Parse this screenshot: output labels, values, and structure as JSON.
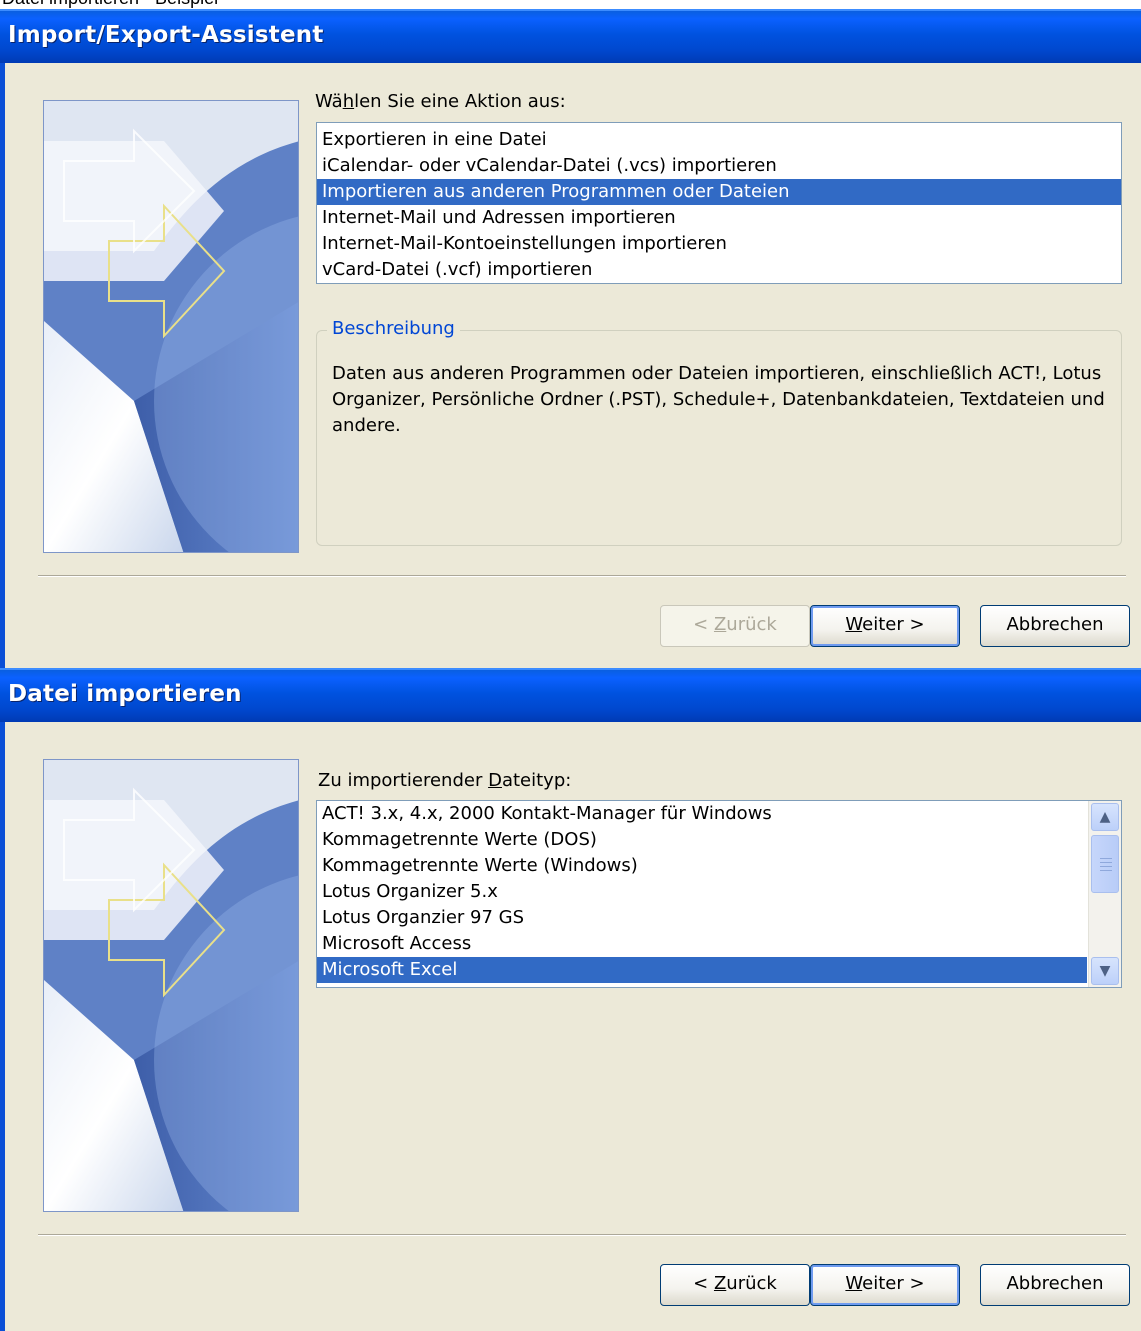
{
  "cutoff_text": "Datei importieren - Beispiel",
  "dialog1": {
    "title": "Import/Export-Assistent",
    "prompt_pre": "Wä",
    "prompt_u": "h",
    "prompt_post": "len Sie eine Aktion aus:",
    "items": [
      "Exportieren in eine Datei",
      "iCalendar- oder vCalendar-Datei (.vcs) importieren",
      "Importieren aus anderen Programmen oder Dateien",
      "Internet-Mail und Adressen importieren",
      "Internet-Mail-Kontoeinstellungen importieren",
      "vCard-Datei (.vcf) importieren"
    ],
    "selected_index": 2,
    "group_title": "Beschreibung",
    "description": "Daten aus anderen Programmen oder Dateien importieren, einschließlich ACT!, Lotus Organizer, Persönliche Ordner (.PST), Schedule+, Datenbankdateien, Textdateien und andere."
  },
  "dialog2": {
    "title": "Datei importieren",
    "prompt_pre": "Zu importierender ",
    "prompt_u": "D",
    "prompt_post": "ateityp:",
    "items": [
      "ACT! 3.x, 4.x, 2000 Kontakt-Manager für Windows",
      "Kommagetrennte Werte (DOS)",
      "Kommagetrennte Werte (Windows)",
      "Lotus Organizer 5.x",
      "Lotus Organzier 97 GS",
      "Microsoft Access",
      "Microsoft Excel"
    ],
    "selected_index": 6
  },
  "buttons": {
    "back_pre": "< ",
    "back_u": "Z",
    "back_post": "urück",
    "next_u": "W",
    "next_post": "eiter >",
    "cancel": "Abbrechen"
  },
  "colors": {
    "titlebar": "#0052df",
    "selection": "#316ac5",
    "dialog_bg": "#ece9d8",
    "group_title": "#0046d5"
  }
}
